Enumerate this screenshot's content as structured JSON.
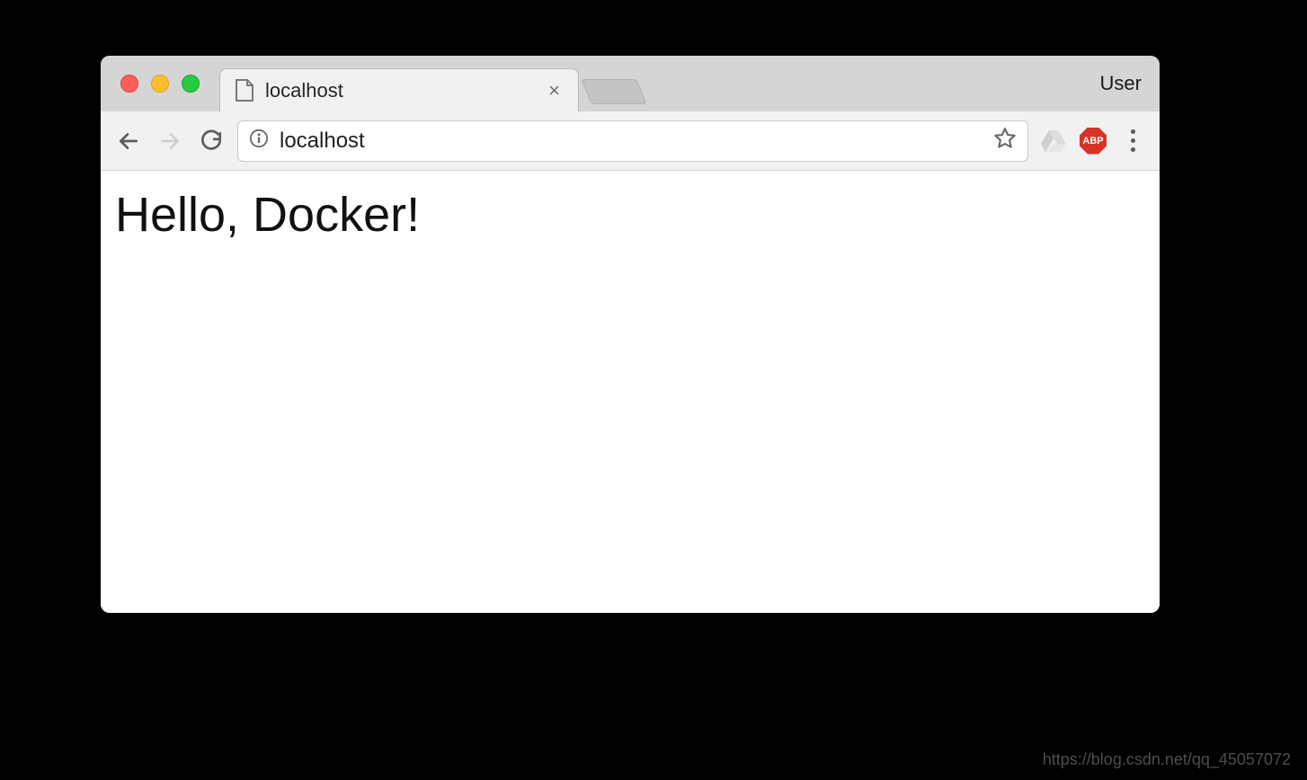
{
  "tabstrip": {
    "tab_title": "localhost",
    "close_glyph": "×",
    "profile_label": "User"
  },
  "toolbar": {
    "url": "localhost",
    "abp_label": "ABP"
  },
  "page": {
    "heading": "Hello, Docker!"
  },
  "watermark": "https://blog.csdn.net/qq_45057072"
}
